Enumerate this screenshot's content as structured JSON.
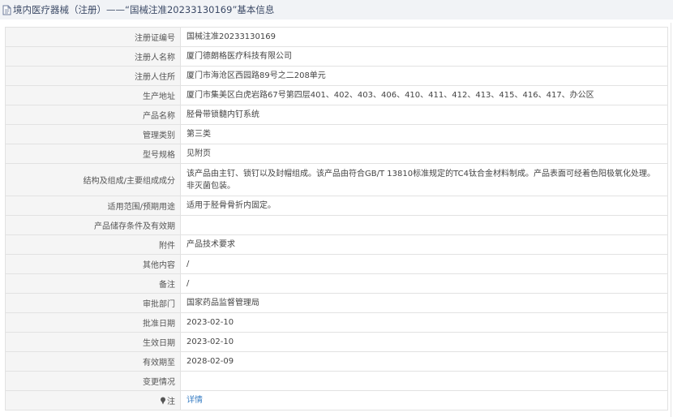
{
  "header": {
    "title": "境内医疗器械（注册）——“国械注准20233130169”基本信息",
    "icon": "document-icon"
  },
  "rows": [
    {
      "key": "reg_no",
      "label": "注册证编号",
      "value": "国械注准20233130169"
    },
    {
      "key": "registrant_name",
      "label": "注册人名称",
      "value": "厦门德朗格医疗科技有限公司"
    },
    {
      "key": "registrant_address",
      "label": "注册人住所",
      "value": "厦门市海沧区西园路89号之二208单元"
    },
    {
      "key": "production_address",
      "label": "生产地址",
      "value": "厦门市集美区白虎岩路67号第四层401、402、403、406、410、411、412、413、415、416、417、办公区"
    },
    {
      "key": "product_name",
      "label": "产品名称",
      "value": "胫骨带锁髓内钉系统"
    },
    {
      "key": "management_class",
      "label": "管理类别",
      "value": "第三类"
    },
    {
      "key": "model_spec",
      "label": "型号规格",
      "value": "见附页"
    },
    {
      "key": "structure",
      "label": "结构及组成/主要组成成分",
      "value": "该产品由主钉、锁钉以及封帽组成。该产品由符合GB/T 13810标准规定的TC4钛合金材料制成。产品表面可经着色阳极氧化处理。非灭菌包装。"
    },
    {
      "key": "scope",
      "label": "适用范围/预期用途",
      "value": "适用于胫骨骨折内固定。"
    },
    {
      "key": "storage",
      "label": "产品储存条件及有效期",
      "value": ""
    },
    {
      "key": "attachment",
      "label": "附件",
      "value": "产品技术要求"
    },
    {
      "key": "other",
      "label": "其他内容",
      "value": "/"
    },
    {
      "key": "remark",
      "label": "备注",
      "value": "/"
    },
    {
      "key": "approval_dept",
      "label": "审批部门",
      "value": "国家药品监督管理局"
    },
    {
      "key": "approval_date",
      "label": "批准日期",
      "value": "2023-02-10"
    },
    {
      "key": "effective_date",
      "label": "生效日期",
      "value": "2023-02-10"
    },
    {
      "key": "expiry_date",
      "label": "有效期至",
      "value": "2028-02-09"
    },
    {
      "key": "change_status",
      "label": "变更情况",
      "value": ""
    },
    {
      "key": "note",
      "label": "注",
      "value": "详情",
      "icon": "pin-icon",
      "link": true
    }
  ]
}
